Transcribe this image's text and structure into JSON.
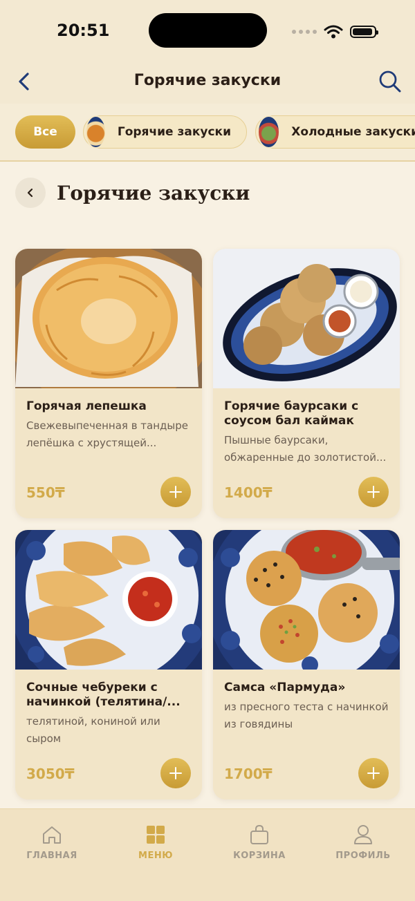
{
  "status_bar": {
    "time": "20:51"
  },
  "nav": {
    "title": "Горячие закуски"
  },
  "categories": {
    "all_label": "Все",
    "items": [
      {
        "label": "Горячие закуски"
      },
      {
        "label": "Холодные закуски"
      }
    ]
  },
  "section": {
    "title": "Горячие закуски"
  },
  "products": [
    {
      "name": "Горячая лепешка",
      "description": "Свежевыпеченная в тандыре лепёшка с хрустящей...",
      "price": "550₸"
    },
    {
      "name": "Горячие баурсаки с соусом бал каймак",
      "description": "Пышные баурсаки, обжаренные до золотистой...",
      "price": "1400₸"
    },
    {
      "name": "Сочные чебуреки с начинкой (телятина/...",
      "description": "телятиной, кониной или сыром",
      "price": "3050₸"
    },
    {
      "name": "Самса «Пармуда»",
      "description": "из пресного теста с начинкой из говядины",
      "price": "1700₸"
    }
  ],
  "tab_bar": {
    "items": [
      {
        "label": "ГЛАВНАЯ",
        "icon": "home-icon"
      },
      {
        "label": "МЕНЮ",
        "icon": "grid-icon",
        "active": true
      },
      {
        "label": "КОРЗИНА",
        "icon": "bag-icon"
      },
      {
        "label": "ПРОФИЛЬ",
        "icon": "profile-icon"
      }
    ]
  },
  "colors": {
    "accent": "#d2aa4a",
    "background": "#f8f1e3",
    "card": "#f2e5c8"
  }
}
